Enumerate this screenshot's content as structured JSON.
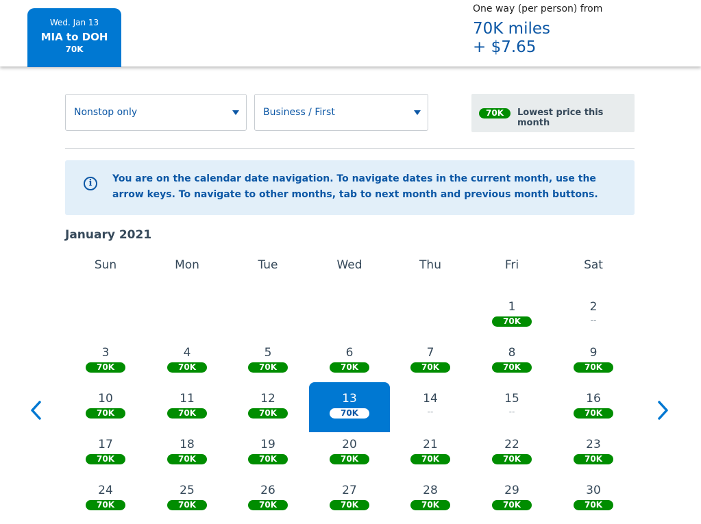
{
  "header": {
    "tab": {
      "date": "Wed. Jan 13",
      "route": "MIA to DOH",
      "miles": "70K"
    },
    "price": {
      "label": "One way (per person) from",
      "miles": "70K miles",
      "tax": "+ $7.65"
    }
  },
  "filters": {
    "stops": "Nonstop only",
    "cabin": "Business / First",
    "legend_badge": "70K",
    "legend_text": "Lowest price this month"
  },
  "info": {
    "icon": "info-icon",
    "text": "You are on the calendar date navigation. To navigate dates in the current month, use the arrow keys. To navigate to other months, tab to next month and previous month buttons."
  },
  "calendar": {
    "month": "January 2021",
    "days_of_week": [
      "Sun",
      "Mon",
      "Tue",
      "Wed",
      "Thu",
      "Fri",
      "Sat"
    ],
    "prev_icon": "chevron-left-icon",
    "next_icon": "chevron-right-icon",
    "first_weekday": 5,
    "selected": "13",
    "days": [
      {
        "day": "1",
        "price": "70K"
      },
      {
        "day": "2",
        "price": "--"
      },
      {
        "day": "3",
        "price": "70K"
      },
      {
        "day": "4",
        "price": "70K"
      },
      {
        "day": "5",
        "price": "70K"
      },
      {
        "day": "6",
        "price": "70K"
      },
      {
        "day": "7",
        "price": "70K"
      },
      {
        "day": "8",
        "price": "70K"
      },
      {
        "day": "9",
        "price": "70K"
      },
      {
        "day": "10",
        "price": "70K"
      },
      {
        "day": "11",
        "price": "70K"
      },
      {
        "day": "12",
        "price": "70K"
      },
      {
        "day": "13",
        "price": "70K"
      },
      {
        "day": "14",
        "price": "--"
      },
      {
        "day": "15",
        "price": "--"
      },
      {
        "day": "16",
        "price": "70K"
      },
      {
        "day": "17",
        "price": "70K"
      },
      {
        "day": "18",
        "price": "70K"
      },
      {
        "day": "19",
        "price": "70K"
      },
      {
        "day": "20",
        "price": "70K"
      },
      {
        "day": "21",
        "price": "70K"
      },
      {
        "day": "22",
        "price": "70K"
      },
      {
        "day": "23",
        "price": "70K"
      },
      {
        "day": "24",
        "price": "70K"
      },
      {
        "day": "25",
        "price": "70K"
      },
      {
        "day": "26",
        "price": "70K"
      },
      {
        "day": "27",
        "price": "70K"
      },
      {
        "day": "28",
        "price": "70K"
      },
      {
        "day": "29",
        "price": "70K"
      },
      {
        "day": "30",
        "price": "70K"
      }
    ]
  },
  "colors": {
    "accent": "#0078d2",
    "price_green": "#008d00",
    "info_bg": "#e2eff9"
  }
}
